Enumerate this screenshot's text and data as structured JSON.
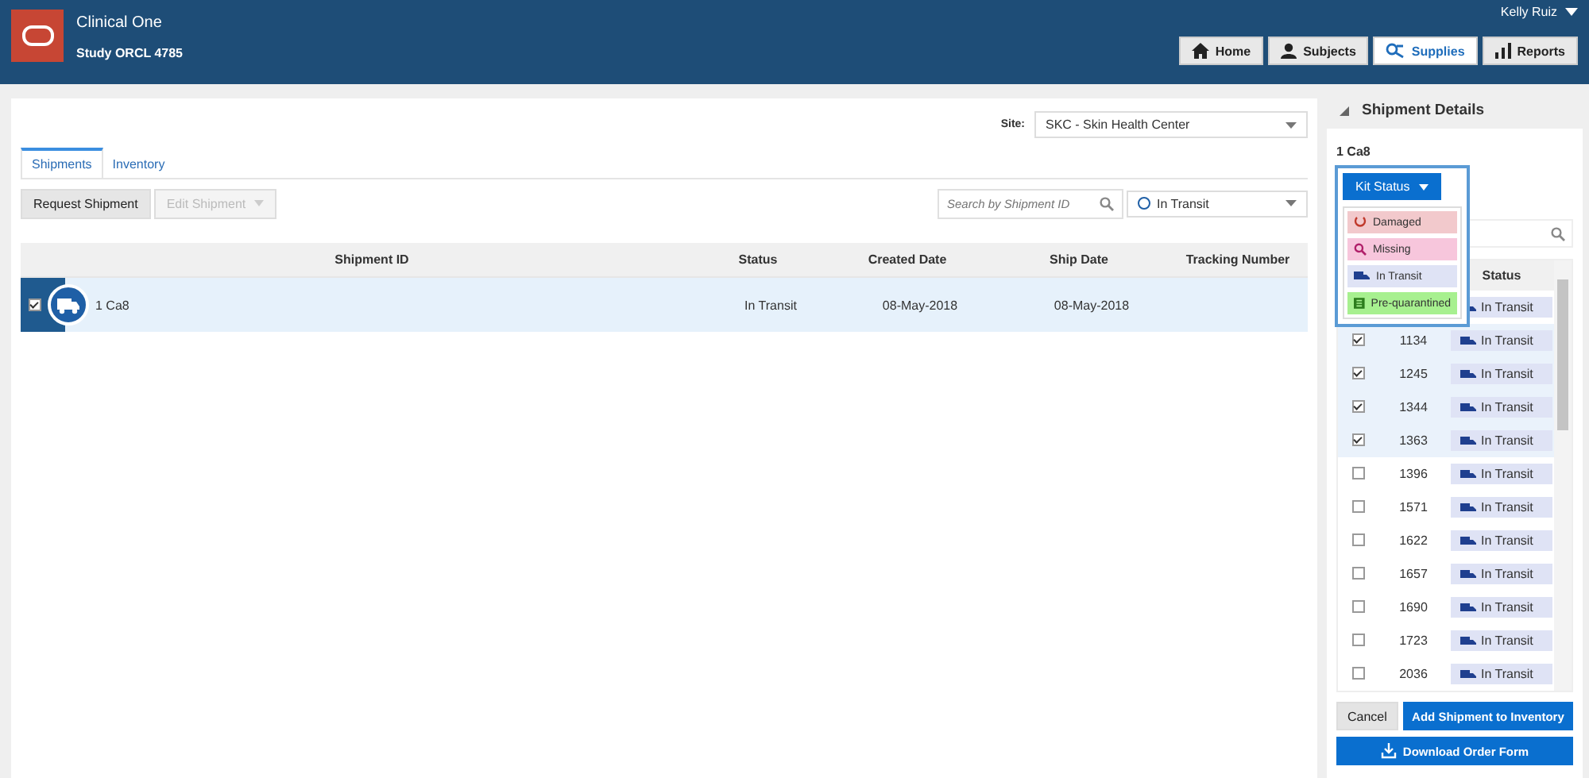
{
  "header": {
    "app_name": "Clinical One",
    "study": "Study ORCL 4785",
    "user": "Kelly Ruiz",
    "nav": [
      {
        "label": "Home",
        "selected": false
      },
      {
        "label": "Subjects",
        "selected": false
      },
      {
        "label": "Supplies",
        "selected": true
      },
      {
        "label": "Reports",
        "selected": false
      }
    ]
  },
  "site": {
    "label": "Site:",
    "value": "SKC - Skin Health Center"
  },
  "tabs": [
    {
      "label": "Shipments",
      "selected": true
    },
    {
      "label": "Inventory",
      "selected": false
    }
  ],
  "toolbar": {
    "buttons": [
      {
        "label": "Request Shipment",
        "disabled": false
      },
      {
        "label": "Edit Shipment",
        "disabled": true
      }
    ],
    "search": {
      "placeholder": "Search by Shipment ID"
    },
    "status_filter": "In Transit"
  },
  "table": {
    "columns": [
      "Shipment ID",
      "Status",
      "Created Date",
      "Ship Date",
      "Tracking Number"
    ],
    "rows": [
      {
        "checked": true,
        "selected": true,
        "id": "1 Ca8",
        "status": "In Transit",
        "created": "08-May-2018",
        "shipped": "08-May-2018"
      }
    ]
  },
  "details": {
    "title": "Shipment Details",
    "shipment": "1 Ca8",
    "kit_status_button": "Kit Status",
    "kit_status_options": [
      {
        "label": "Damaged",
        "color": "#f2c9cc"
      },
      {
        "label": "Missing",
        "color": "#f7c6dc"
      },
      {
        "label": "In Transit",
        "color": "#dfe3f5"
      },
      {
        "label": "Pre-quarantined",
        "color": "#a7f08f"
      }
    ],
    "status_column": "Status",
    "kits": [
      {
        "status": "In Transit"
      },
      {
        "kit": "1134",
        "checked": true,
        "status": "In Transit"
      },
      {
        "kit": "1245",
        "checked": true,
        "status": "In Transit"
      },
      {
        "kit": "1344",
        "checked": true,
        "status": "In Transit"
      },
      {
        "kit": "1363",
        "checked": true,
        "status": "In Transit"
      },
      {
        "kit": "1396",
        "checked": false,
        "status": "In Transit"
      },
      {
        "kit": "1571",
        "checked": false,
        "status": "In Transit"
      },
      {
        "kit": "1622",
        "checked": false,
        "status": "In Transit"
      },
      {
        "kit": "1657",
        "checked": false,
        "status": "In Transit"
      },
      {
        "kit": "1690",
        "checked": false,
        "status": "In Transit"
      },
      {
        "kit": "1723",
        "checked": false,
        "status": "In Transit"
      },
      {
        "kit": "2036",
        "checked": false,
        "status": "In Transit"
      }
    ],
    "buttons": {
      "cancel": "Cancel",
      "add": "Add Shipment to Inventory",
      "download": "Download Order Form"
    }
  }
}
